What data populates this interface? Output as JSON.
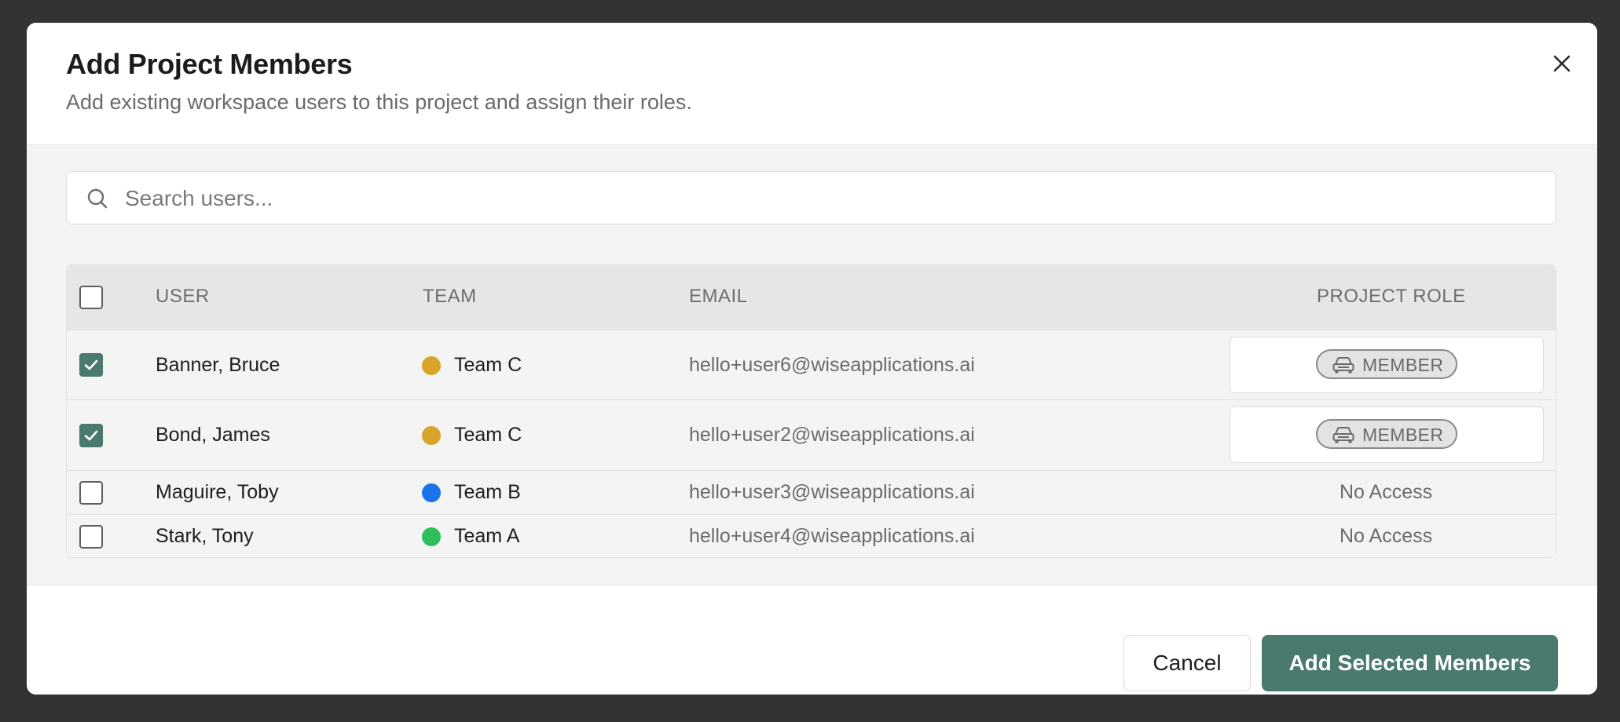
{
  "dialog": {
    "title": "Add Project Members",
    "subtitle": "Add existing workspace users to this project and assign their roles.",
    "close_icon": "close-icon"
  },
  "search": {
    "placeholder": "Search users...",
    "value": "",
    "icon": "search-icon"
  },
  "table": {
    "columns": [
      "USER",
      "TEAM",
      "EMAIL",
      "PROJECT ROLE"
    ],
    "rows": [
      {
        "checked": true,
        "user": "Banner, Bruce",
        "team": "Team C",
        "team_color": "#d8a52a",
        "email": "hello+user6@wiseapplications.ai",
        "role": "MEMBER",
        "role_icon": "car-icon"
      },
      {
        "checked": true,
        "user": "Bond, James",
        "team": "Team C",
        "team_color": "#d8a52a",
        "email": "hello+user2@wiseapplications.ai",
        "role": "MEMBER",
        "role_icon": "car-icon"
      },
      {
        "checked": false,
        "user": "Maguire, Toby",
        "team": "Team B",
        "team_color": "#1a73e8",
        "email": "hello+user3@wiseapplications.ai",
        "role": "No Access"
      },
      {
        "checked": false,
        "user": "Stark, Tony",
        "team": "Team A",
        "team_color": "#2ebf5a",
        "email": "hello+user4@wiseapplications.ai",
        "role": "No Access"
      }
    ]
  },
  "footer": {
    "cancel_label": "Cancel",
    "submit_label": "Add Selected Members"
  },
  "colors": {
    "accent": "#4a7a6d",
    "backdrop": "#333333"
  }
}
